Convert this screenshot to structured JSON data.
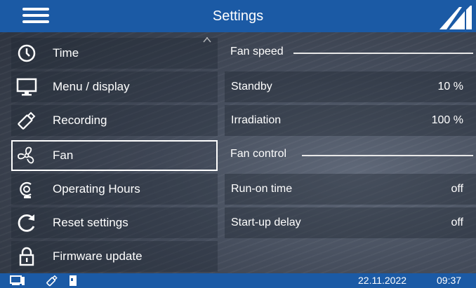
{
  "header": {
    "title": "Settings",
    "menu_icon": "hamburger-menu-icon",
    "logo_icon": "brand-logo-icon"
  },
  "sidebar": {
    "items": [
      {
        "label": "Time",
        "icon": "clock-icon"
      },
      {
        "label": "Menu / display",
        "icon": "monitor-icon"
      },
      {
        "label": "Recording",
        "icon": "usb-stick-icon"
      },
      {
        "label": "Fan",
        "icon": "fan-icon",
        "selected": true
      },
      {
        "label": "Operating Hours",
        "icon": "hours-counter-icon"
      },
      {
        "label": "Reset settings",
        "icon": "reset-arrow-icon"
      },
      {
        "label": "Firmware update",
        "icon": "lock-icon"
      }
    ]
  },
  "main": {
    "fan_speed": {
      "heading": "Fan speed",
      "rows": [
        {
          "label": "Standby",
          "value": "10 %"
        },
        {
          "label": "Irradiation",
          "value": "100 %"
        }
      ]
    },
    "fan_control": {
      "heading": "Fan control",
      "rows": [
        {
          "label": "Run-on time",
          "value": "off"
        },
        {
          "label": "Start-up delay",
          "value": "off"
        }
      ]
    }
  },
  "status": {
    "date": "22.11.2022",
    "time": "09:37",
    "icons": [
      "computer-icon",
      "usb-stick-icon",
      "sd-card-icon"
    ]
  },
  "colors": {
    "bar_blue": "#1b5aa5",
    "selection_border": "#ffffff"
  }
}
